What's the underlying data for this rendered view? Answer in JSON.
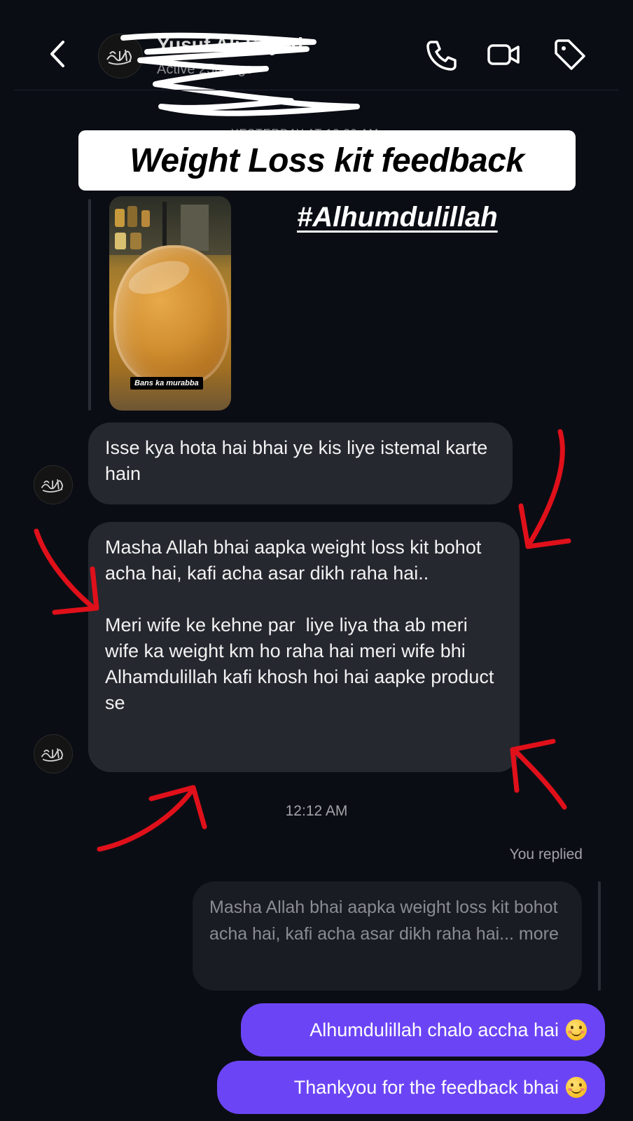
{
  "header": {
    "contact_name": "Yusuf Ali Sayed",
    "active_status": "Active 25m ago",
    "icons": [
      "back-chevron",
      "phone",
      "video-camera",
      "tag"
    ]
  },
  "story": {
    "date_stamp": "YESTERDAY AT 12:30 AM",
    "banner_text": "Weight Loss kit feedback",
    "hashtag": "#Alhumdulillah",
    "thumbnail_label": "Bans ka murabba"
  },
  "messages": {
    "incoming_1": "Isse kya hota hai bhai ye kis liye istemal karte hain",
    "incoming_2_para1": "Masha Allah bhai aapka weight loss kit bohot acha hai, kafi acha asar dikh raha hai..",
    "incoming_2_para2": "Meri wife ke kehne par  liye liya tha ab meri wife ka weight km ho raha hai meri wife bhi Alhamdulillah kafi khosh hoi hai aapke product se",
    "timestamp": "12:12 AM",
    "you_replied": "You replied",
    "quoted_text": "Masha Allah bhai aapka weight loss kit bohot acha hai, kafi acha asar dikh raha hai... more",
    "outgoing_1": "Alhumdulillah chalo accha hai",
    "outgoing_2": "Thankyou for the feedback bhai"
  },
  "colors": {
    "background": "#0b0d14",
    "incoming_bubble": "#262830",
    "outgoing_bubble": "#6b45f5",
    "annotation_red": "#e0101a"
  }
}
